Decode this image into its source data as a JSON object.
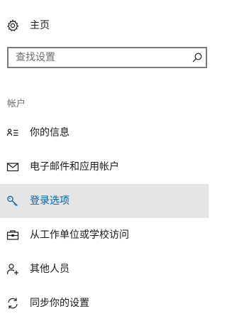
{
  "home": {
    "label": "主页",
    "icon": "gear-icon"
  },
  "search": {
    "placeholder": "查找设置",
    "value": "",
    "icon": "search-icon"
  },
  "section": {
    "header": "帐户"
  },
  "nav": {
    "items": [
      {
        "label": "你的信息",
        "icon": "person-card-icon",
        "selected": false
      },
      {
        "label": "电子邮件和应用帐户",
        "icon": "mail-icon",
        "selected": false
      },
      {
        "label": "登录选项",
        "icon": "key-icon",
        "selected": true
      },
      {
        "label": "从工作单位或学校访问",
        "icon": "briefcase-icon",
        "selected": false
      },
      {
        "label": "其他人员",
        "icon": "add-person-icon",
        "selected": false
      },
      {
        "label": "同步你的设置",
        "icon": "sync-icon",
        "selected": false
      }
    ]
  },
  "colors": {
    "accent": "#0063b1",
    "selected_background": "#e5e5e5",
    "search_border": "#7a7a7a",
    "secondary_text": "#6d6d6d"
  }
}
